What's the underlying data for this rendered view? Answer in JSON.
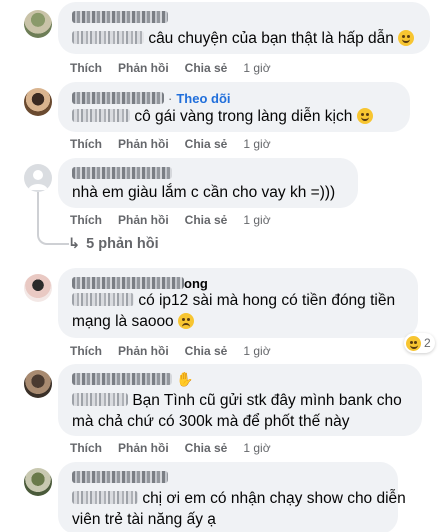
{
  "comments": [
    {
      "text": "câu chuyện của bạn thật là hấp dẫn",
      "actions": {
        "like": "Thích",
        "reply": "Phản hồi",
        "share": "Chia sẻ",
        "time": "1 giờ"
      }
    },
    {
      "follow_label": "Theo dõi",
      "text": "cô gái vàng trong làng diễn kịch",
      "actions": {
        "like": "Thích",
        "reply": "Phản hồi",
        "share": "Chia sẻ",
        "time": "1 giờ"
      }
    },
    {
      "text": "nhà em giàu lắm c cần cho vay kh =)))",
      "actions": {
        "like": "Thích",
        "reply": "Phản hồi",
        "share": "Chia sẻ",
        "time": "1 giờ"
      },
      "replies_label": "5 phản hồi"
    },
    {
      "name_fragment": "ong",
      "text_line1": "có ip12 sài mà hong có tiền đóng tiền",
      "text_line2": "mạng là saooo",
      "actions": {
        "like": "Thích",
        "reply": "Phản hồi",
        "share": "Chia sẻ",
        "time": "1 giờ"
      },
      "reaction_count": "2"
    },
    {
      "text_line1": "Bạn Tình cũ gửi stk đây mình bank cho",
      "text_line2": "mà chả chứ có 300k mà để phốt thế này",
      "actions": {
        "like": "Thích",
        "reply": "Phản hồi",
        "share": "Chia sẻ",
        "time": "1 giờ"
      }
    },
    {
      "text_line1": "chị ơi em có nhận chạy show cho diễn",
      "text_line2": "viên trẻ tài năng ấy ạ"
    }
  ],
  "colors": {
    "bubble": "#f0f2f5",
    "action_text": "#65676b",
    "follow": "#216fdb"
  }
}
